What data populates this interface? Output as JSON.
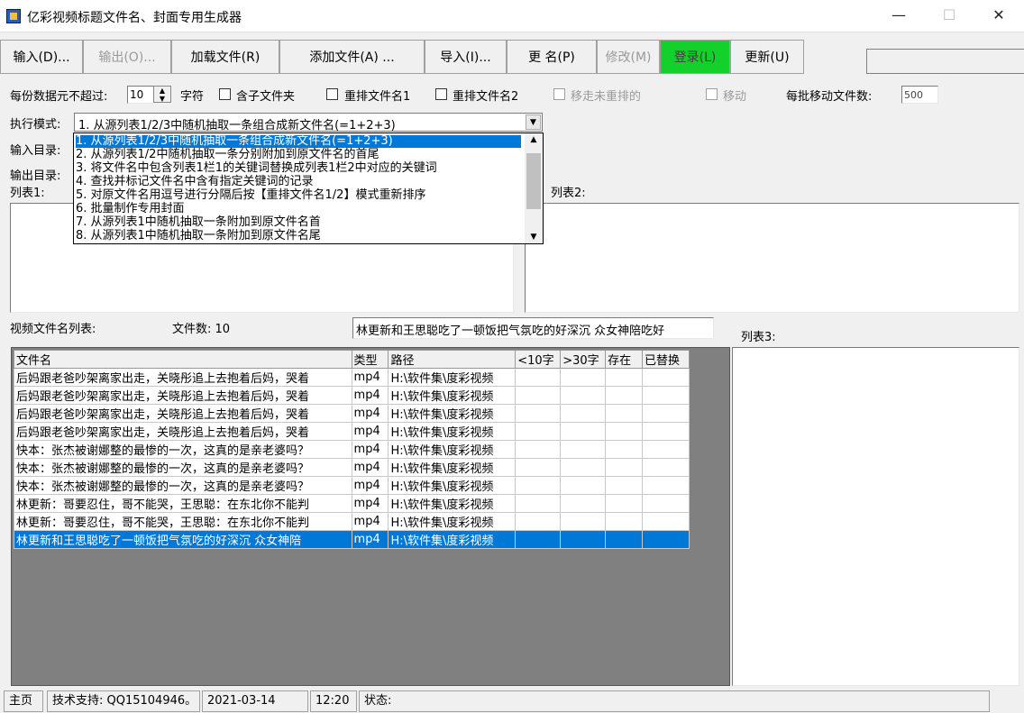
{
  "window": {
    "title": "亿彩视频标题文件名、封面专用生成器",
    "minimize": "—",
    "maximize": "☐",
    "close": "✕"
  },
  "toolbar": {
    "input": "输入(D)...",
    "output": "输出(O)...",
    "load_file": "加载文件(R)",
    "add_file": "添加文件(A) ...",
    "import": "导入(I)...",
    "rename": "更  名(P)",
    "modify": "修改(M)",
    "login": "登录(L)",
    "update": "更新(U)",
    "login_color": "#14d02a"
  },
  "options": {
    "max_units_label": "每份数据元不超过:",
    "max_units_value": "10",
    "unit": "字符",
    "include_subfolders": "含子文件夹",
    "reorder1": "重排文件名1",
    "reorder2": "重排文件名2",
    "move_unsorted": "移走未重排的",
    "move": "移动",
    "batch_move_label": "每批移动文件数:",
    "batch_move_value": "500"
  },
  "mode": {
    "label": "执行模式:",
    "selected": "1. 从源列表1/2/3中随机抽取一条组合成新文件名(=1+2+3)",
    "options": [
      "1. 从源列表1/2/3中随机抽取一条组合成新文件名(=1+2+3)",
      "2. 从源列表1/2中随机抽取一条分别附加到原文件名的首尾",
      "3. 将文件名中包含列表1栏1的关键词替换成列表1栏2中对应的关键词",
      "4. 查找并标记文件名中含有指定关键词的记录",
      "5. 对原文件名用逗号进行分隔后按【重排文件名1/2】模式重新排序",
      "6. 批量制作专用封面",
      "7. 从源列表1中随机抽取一条附加到原文件名首",
      "8. 从源列表1中随机抽取一条附加到原文件名尾"
    ]
  },
  "labels": {
    "input_dir": "输入目录:",
    "output_dir": "输出目录:",
    "list1": "列表1:",
    "list2": "列表2:",
    "list3": "列表3:",
    "video_list": "视频文件名列表:",
    "file_count": "文件数: 10",
    "current_name": "林更新和王思聪吃了一顿饭把气氛吃的好深沉 众女神陪吃好"
  },
  "table": {
    "headers": [
      "文件名",
      "类型",
      "路径",
      "<10字",
      ">30字",
      "存在",
      "已替换"
    ],
    "rows": [
      [
        "后妈跟老爸吵架离家出走，关晓彤追上去抱着后妈，哭着",
        "mp4",
        "H:\\软件集\\度彩视频"
      ],
      [
        "后妈跟老爸吵架离家出走，关晓彤追上去抱着后妈，哭着",
        "mp4",
        "H:\\软件集\\度彩视频"
      ],
      [
        "后妈跟老爸吵架离家出走，关晓彤追上去抱着后妈，哭着",
        "mp4",
        "H:\\软件集\\度彩视频"
      ],
      [
        "后妈跟老爸吵架离家出走，关晓彤追上去抱着后妈，哭着",
        "mp4",
        "H:\\软件集\\度彩视频"
      ],
      [
        "快本：张杰被谢娜整的最惨的一次，这真的是亲老婆吗？",
        "mp4",
        "H:\\软件集\\度彩视频"
      ],
      [
        "快本：张杰被谢娜整的最惨的一次，这真的是亲老婆吗？",
        "mp4",
        "H:\\软件集\\度彩视频"
      ],
      [
        "快本：张杰被谢娜整的最惨的一次，这真的是亲老婆吗？",
        "mp4",
        "H:\\软件集\\度彩视频"
      ],
      [
        "林更新：哥要忍住，哥不能哭，王思聪：在东北你不能判",
        "mp4",
        "H:\\软件集\\度彩视频"
      ],
      [
        "林更新：哥要忍住，哥不能哭，王思聪：在东北你不能判",
        "mp4",
        "H:\\软件集\\度彩视频"
      ],
      [
        "林更新和王思聪吃了一顿饭把气氛吃的好深沉 众女神陪",
        "mp4",
        "H:\\软件集\\度彩视频"
      ]
    ]
  },
  "status": {
    "home": "主页",
    "support": "技术支持: QQ15104946。",
    "date": "2021-03-14",
    "time": "12:20",
    "state": "状态:"
  }
}
